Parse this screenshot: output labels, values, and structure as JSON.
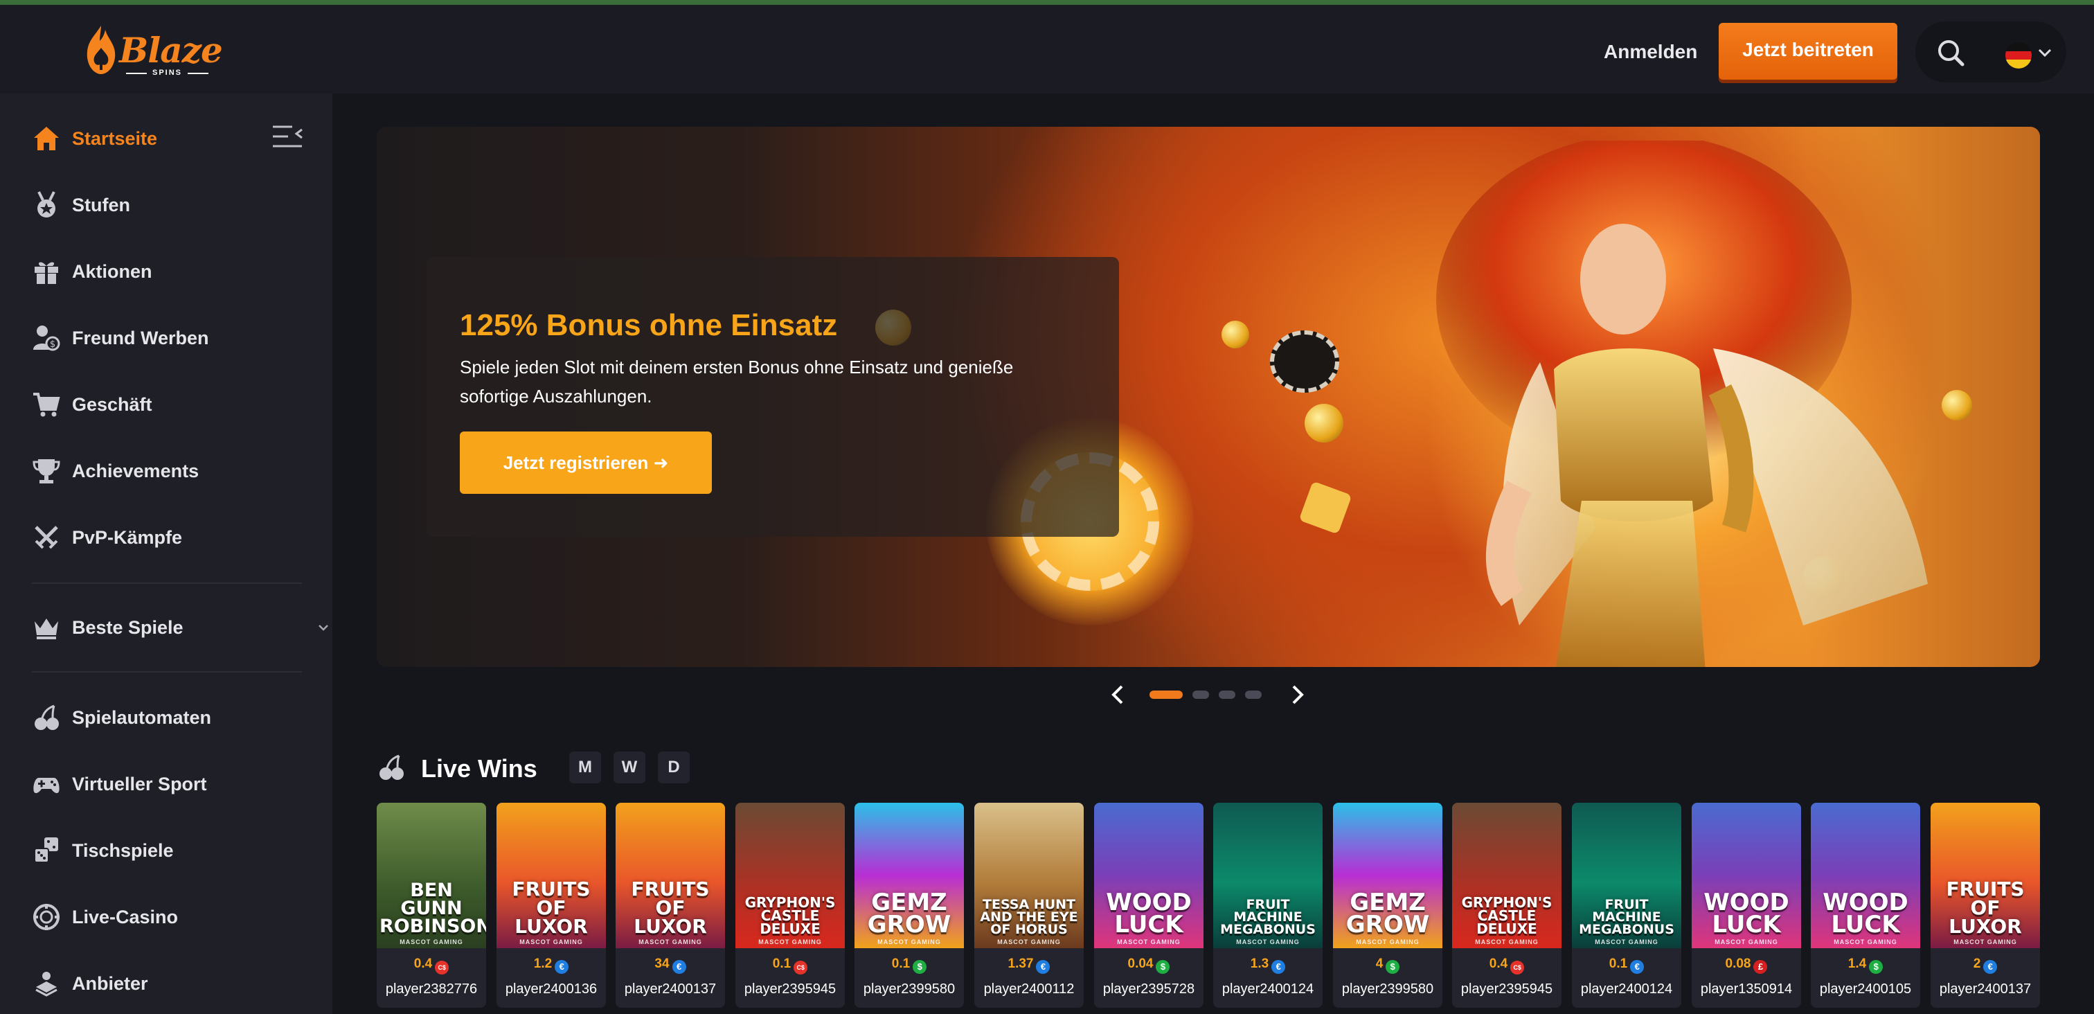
{
  "brand": {
    "name": "Blaze",
    "sub": "SPINS",
    "color": "#f5841f"
  },
  "header": {
    "login_label": "Anmelden",
    "join_label": "Jetzt beitreten",
    "language": "de"
  },
  "sidebar": {
    "items": [
      {
        "label": "Startseite",
        "icon": "home-icon",
        "active": true
      },
      {
        "label": "Stufen",
        "icon": "medal-icon"
      },
      {
        "label": "Aktionen",
        "icon": "gift-icon"
      },
      {
        "label": "Freund Werben",
        "icon": "refer-friend-icon"
      },
      {
        "label": "Geschäft",
        "icon": "cart-icon"
      },
      {
        "label": "Achievements",
        "icon": "trophy-icon"
      },
      {
        "label": "PvP-Kämpfe",
        "icon": "swords-icon"
      }
    ],
    "best_games_label": "Beste Spiele",
    "game_items": [
      {
        "label": "Spielautomaten",
        "icon": "cherries-icon"
      },
      {
        "label": "Virtueller Sport",
        "icon": "gamepad-icon"
      },
      {
        "label": "Tischspiele",
        "icon": "dice-icon"
      },
      {
        "label": "Live-Casino",
        "icon": "chip-icon"
      },
      {
        "label": "Anbieter",
        "icon": "provider-icon"
      }
    ]
  },
  "hero": {
    "title": "125% Bonus ohne Einsatz",
    "description": "Spiele jeden Slot mit deinem ersten Bonus ohne Einsatz und genieße sofortige Auszahlungen.",
    "cta_label": "Jetzt registrieren ➜",
    "slides_count": 4,
    "active_slide": 1
  },
  "live_wins": {
    "title": "Live Wins",
    "filters": [
      "M",
      "W",
      "D"
    ],
    "currency_colors": {
      "C$": "#e5322a",
      "€": "#1f7ee0",
      "$": "#1fae43",
      "£": "#d42020"
    },
    "items": [
      {
        "game": "BEN GUNN ROBINSON",
        "amount": "0.4",
        "currency": "C$",
        "player": "player2382776",
        "theme": "ben"
      },
      {
        "game": "FRUITS OF LUXOR",
        "amount": "1.2",
        "currency": "€",
        "player": "player2400136",
        "theme": "luxor"
      },
      {
        "game": "FRUITS OF LUXOR",
        "amount": "34",
        "currency": "€",
        "player": "player2400137",
        "theme": "luxor"
      },
      {
        "game": "GRYPHON'S CASTLE DELUXE",
        "amount": "0.1",
        "currency": "C$",
        "player": "player2395945",
        "theme": "gryphon"
      },
      {
        "game": "GEMZ GROW",
        "amount": "0.1",
        "currency": "$",
        "player": "player2399580",
        "theme": "gemz"
      },
      {
        "game": "TESSA HUNT AND THE EYE OF HORUS",
        "amount": "1.37",
        "currency": "€",
        "player": "player2400112",
        "theme": "tessa"
      },
      {
        "game": "WOOD LUCK",
        "amount": "0.04",
        "currency": "$",
        "player": "player2395728",
        "theme": "wood"
      },
      {
        "game": "FRUIT MACHINE MEGABONUS",
        "amount": "1.3",
        "currency": "€",
        "player": "player2400124",
        "theme": "fruit"
      },
      {
        "game": "GEMZ GROW",
        "amount": "4",
        "currency": "$",
        "player": "player2399580",
        "theme": "gemz"
      },
      {
        "game": "GRYPHON'S CASTLE DELUXE",
        "amount": "0.4",
        "currency": "C$",
        "player": "player2395945",
        "theme": "gryphon"
      },
      {
        "game": "FRUIT MACHINE MEGABONUS",
        "amount": "0.1",
        "currency": "€",
        "player": "player2400124",
        "theme": "fruit"
      },
      {
        "game": "WOOD LUCK",
        "amount": "0.08",
        "currency": "£",
        "player": "player1350914",
        "theme": "wood"
      },
      {
        "game": "WOOD LUCK",
        "amount": "1.4",
        "currency": "$",
        "player": "player2400105",
        "theme": "wood"
      },
      {
        "game": "FRUITS OF LUXOR",
        "amount": "2",
        "currency": "€",
        "player": "player2400137",
        "theme": "luxor"
      }
    ],
    "studio_label": "MASCOT GAMING"
  }
}
